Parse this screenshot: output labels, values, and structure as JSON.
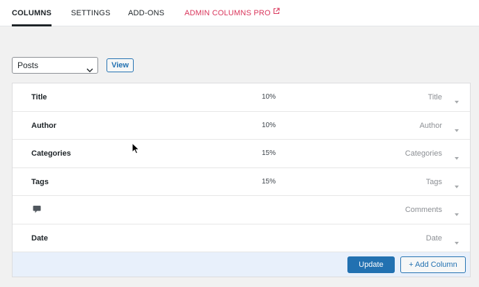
{
  "nav": {
    "tabs": [
      {
        "label": "COLUMNS",
        "active": true
      },
      {
        "label": "SETTINGS",
        "active": false
      },
      {
        "label": "ADD-ONS",
        "active": false
      },
      {
        "label": "ADMIN COLUMNS PRO",
        "active": false,
        "icon": "external-link-icon"
      }
    ]
  },
  "toolbar": {
    "selected_type": "Posts",
    "view_label": "View"
  },
  "columns": [
    {
      "label": "Title",
      "width": "10%",
      "type": "Title"
    },
    {
      "label": "Author",
      "width": "10%",
      "type": "Author"
    },
    {
      "label": "Categories",
      "width": "15%",
      "type": "Categories"
    },
    {
      "label": "Tags",
      "width": "15%",
      "type": "Tags"
    },
    {
      "label": "",
      "icon": "comment-icon",
      "width": "",
      "type": "Comments"
    },
    {
      "label": "Date",
      "width": "",
      "type": "Date"
    }
  ],
  "footer": {
    "update_label": "Update",
    "add_column_label": "+ Add Column"
  },
  "colors": {
    "accent": "#2271b1",
    "pro": "#d9345a",
    "footer_bg": "#e8f0fb"
  }
}
